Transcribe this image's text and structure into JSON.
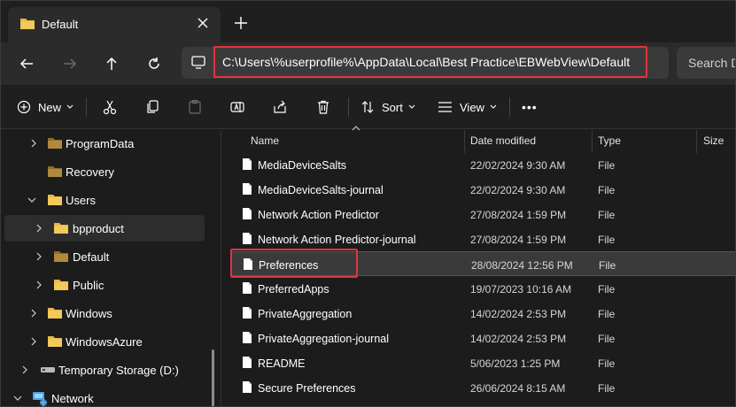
{
  "tab": {
    "title": "Default"
  },
  "address": {
    "path": "C:\\Users\\%userprofile%\\AppData\\Local\\Best Practice\\EBWebView\\Default"
  },
  "search": {
    "placeholder": "Search D"
  },
  "toolbar": {
    "new_label": "New",
    "sort_label": "Sort",
    "view_label": "View",
    "more_label": "•••"
  },
  "nav": {
    "items": [
      {
        "label": "ProgramData",
        "icon": "folder-icon",
        "expandable": true
      },
      {
        "label": "Recovery",
        "icon": "folder-icon",
        "expandable": false
      },
      {
        "label": "Users",
        "icon": "folder-icon",
        "expandable": true,
        "expanded": true
      },
      {
        "label": "bpproduct",
        "icon": "folder-icon",
        "expandable": true,
        "selected": true
      },
      {
        "label": "Default",
        "icon": "folder-icon",
        "expandable": true
      },
      {
        "label": "Public",
        "icon": "folder-icon",
        "expandable": true
      },
      {
        "label": "Windows",
        "icon": "folder-icon",
        "expandable": true
      },
      {
        "label": "WindowsAzure",
        "icon": "folder-icon",
        "expandable": true
      },
      {
        "label": "Temporary Storage (D:)",
        "icon": "drive-icon",
        "expandable": true
      },
      {
        "label": "Network",
        "icon": "network-icon",
        "expandable": true,
        "expanded": true
      }
    ]
  },
  "columns": {
    "name": "Name",
    "date": "Date modified",
    "type": "Type",
    "size": "Size"
  },
  "files": [
    {
      "name": "MediaDeviceSalts",
      "date": "22/02/2024 9:30 AM",
      "type": "File"
    },
    {
      "name": "MediaDeviceSalts-journal",
      "date": "22/02/2024 9:30 AM",
      "type": "File"
    },
    {
      "name": "Network Action Predictor",
      "date": "27/08/2024 1:59 PM",
      "type": "File"
    },
    {
      "name": "Network Action Predictor-journal",
      "date": "27/08/2024 1:59 PM",
      "type": "File"
    },
    {
      "name": "Preferences",
      "date": "28/08/2024 12:56 PM",
      "type": "File",
      "highlighted": true
    },
    {
      "name": "PreferredApps",
      "date": "19/07/2023 10:16 AM",
      "type": "File"
    },
    {
      "name": "PrivateAggregation",
      "date": "14/02/2024 2:53 PM",
      "type": "File"
    },
    {
      "name": "PrivateAggregation-journal",
      "date": "14/02/2024 2:53 PM",
      "type": "File"
    },
    {
      "name": "README",
      "date": "5/06/2023 1:25 PM",
      "type": "File"
    },
    {
      "name": "Secure Preferences",
      "date": "26/06/2024 8:15 AM",
      "type": "File"
    }
  ],
  "colors": {
    "folder": "#e8b84a",
    "highlight_box": "#e1343f",
    "background": "#1c1c1c"
  }
}
